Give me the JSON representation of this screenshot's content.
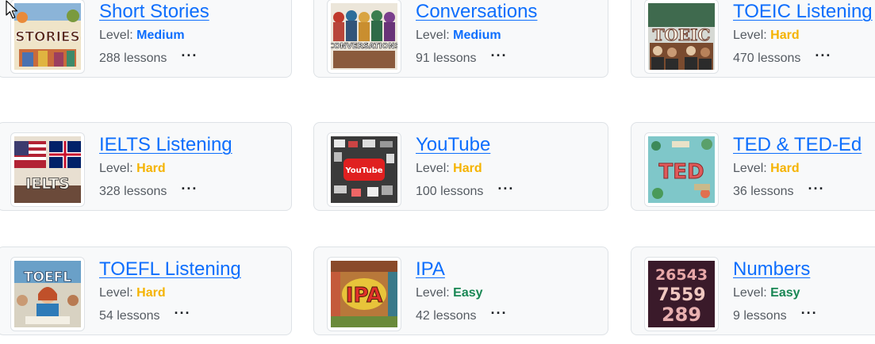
{
  "level_prefix": "Level:",
  "courses": [
    {
      "title": "Short Stories",
      "level": "Medium",
      "level_class": "lv-medium",
      "lessons": "288 lessons",
      "thumb_text": "STORIES",
      "thumb_icon": "stories-thumbnail",
      "more": "···"
    },
    {
      "title": "Conversations",
      "level": "Medium",
      "level_class": "lv-medium",
      "lessons": "91 lessons",
      "thumb_text": "CONVERSATIONS",
      "thumb_icon": "conversations-thumbnail",
      "more": "···"
    },
    {
      "title": "TOEIC Listening",
      "level": "Hard",
      "level_class": "lv-hard",
      "lessons": "470 lessons",
      "thumb_text": "TOEIC",
      "thumb_icon": "toeic-thumbnail",
      "more": "···"
    },
    {
      "title": "IELTS Listening",
      "level": "Hard",
      "level_class": "lv-hard",
      "lessons": "328 lessons",
      "thumb_text": "IELTS",
      "thumb_icon": "ielts-thumbnail",
      "more": "···"
    },
    {
      "title": "YouTube",
      "level": "Hard",
      "level_class": "lv-hard",
      "lessons": "100 lessons",
      "thumb_text": "YouTube",
      "thumb_icon": "youtube-thumbnail",
      "more": "···"
    },
    {
      "title": "TED & TED-Ed",
      "level": "Hard",
      "level_class": "lv-hard",
      "lessons": "36 lessons",
      "thumb_text": "TED",
      "thumb_icon": "ted-thumbnail",
      "more": "···"
    },
    {
      "title": "TOEFL Listening",
      "level": "Hard",
      "level_class": "lv-hard",
      "lessons": "54 lessons",
      "thumb_text": "TOEFL",
      "thumb_icon": "toefl-thumbnail",
      "more": "···"
    },
    {
      "title": "IPA",
      "level": "Easy",
      "level_class": "lv-easy",
      "lessons": "42 lessons",
      "thumb_text": "IPA",
      "thumb_icon": "ipa-thumbnail",
      "more": "···"
    },
    {
      "title": "Numbers",
      "level": "Easy",
      "level_class": "lv-easy",
      "lessons": "9 lessons",
      "thumb_text": "26543\n7559\n289",
      "thumb_icon": "numbers-thumbnail",
      "more": "···"
    }
  ],
  "colors": {
    "link": "#0d6efd",
    "medium": "#0d6efd",
    "hard": "#f5b300",
    "easy": "#198754",
    "card_bg": "#f8f9fa",
    "card_border": "#dee2e6"
  }
}
